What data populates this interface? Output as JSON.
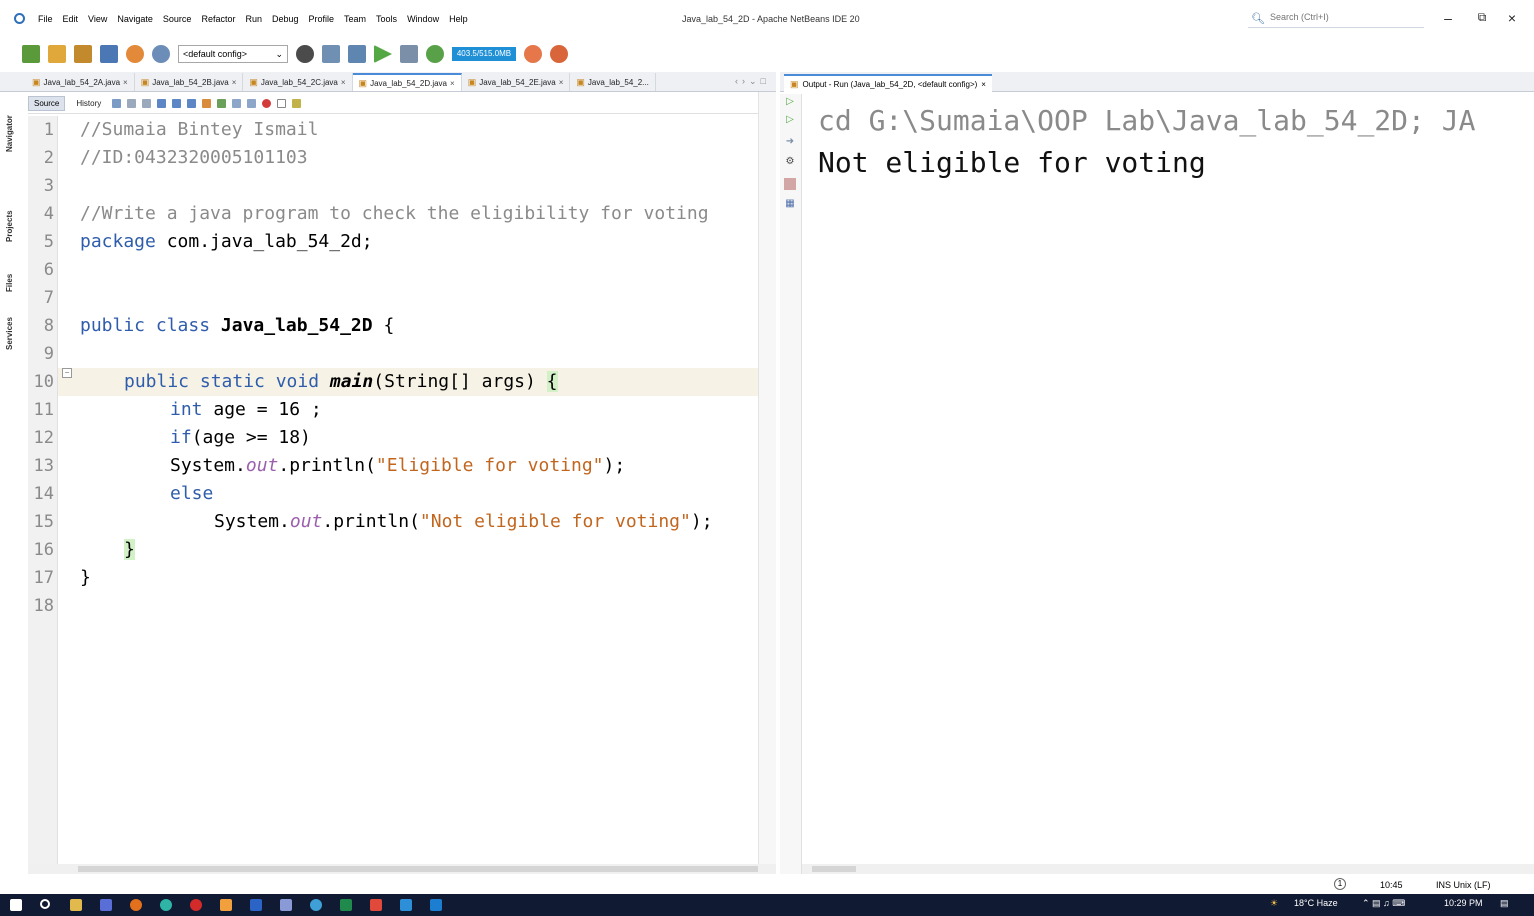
{
  "window": {
    "title": "Java_lab_54_2D - Apache NetBeans IDE 20",
    "menu": [
      "File",
      "Edit",
      "View",
      "Navigate",
      "Source",
      "Refactor",
      "Run",
      "Debug",
      "Profile",
      "Team",
      "Tools",
      "Window",
      "Help"
    ],
    "search_placeholder": "Search (Ctrl+I)"
  },
  "toolbar": {
    "config": "<default config>",
    "memory": "403.5/515.0MB"
  },
  "editor_tabs": [
    {
      "label": "Java_lab_54_2A.java",
      "active": false
    },
    {
      "label": "Java_lab_54_2B.java",
      "active": false
    },
    {
      "label": "Java_lab_54_2C.java",
      "active": false
    },
    {
      "label": "Java_lab_54_2D.java",
      "active": true
    },
    {
      "label": "Java_lab_54_2E.java",
      "active": false
    },
    {
      "label": "Java_lab_54_2...",
      "active": false
    }
  ],
  "side_panels": [
    "Navigator",
    "Projects",
    "Files",
    "Services"
  ],
  "editor": {
    "source_label": "Source",
    "history_label": "History",
    "line_numbers": [
      "1",
      "2",
      "3",
      "4",
      "5",
      "6",
      "7",
      "8",
      "9",
      "10",
      "11",
      "12",
      "13",
      "14",
      "15",
      "16",
      "17",
      "18"
    ],
    "code": {
      "l1": "//Sumaia Bintey Ismail",
      "l2": "//ID:0432320005101103",
      "l4": "//Write a java program to check the eligibility for voting",
      "l5_kw": "package",
      "l5_rest": " com.java_lab_54_2d;",
      "l8_kw": "public class",
      "l8_name": "Java_lab_54_2D",
      "l8_rest": " {",
      "l10_kw": "public static void",
      "l10_name": "main",
      "l10_rest": "(String[] args) ",
      "l10_brace": "{",
      "l11_kw": "int",
      "l11_rest": " age = 16 ;",
      "l12_kw": "if",
      "l12_rest": "(age >= 18)",
      "l13_pre": "System.",
      "l13_out": "out",
      "l13_mid": ".println(",
      "l13_str": "\"Eligible for voting\"",
      "l13_end": ");",
      "l14_kw": "else",
      "l15_pre": "System.",
      "l15_out": "out",
      "l15_mid": ".println(",
      "l15_str": "\"Not eligible for voting\"",
      "l15_end": ");",
      "l16": "}",
      "l17": "}"
    }
  },
  "output": {
    "tab_label": "Output - Run (Java_lab_54_2D, <default config>)",
    "cmd_line": "cd G:\\Sumaia\\OOP Lab\\Java_lab_54_2D; JA",
    "result_line": "Not eligible for voting"
  },
  "status": {
    "notifications": "1",
    "position": "10:45",
    "mode": "INS Unix (LF)"
  },
  "taskbar": {
    "weather": "18°C Haze",
    "time": "10:29 PM"
  },
  "colors": {
    "keyword": "#2f5dab",
    "string": "#c1661f",
    "comment": "#8a8a8a",
    "field": "#9b5fae",
    "taskbar": "#101a33"
  }
}
